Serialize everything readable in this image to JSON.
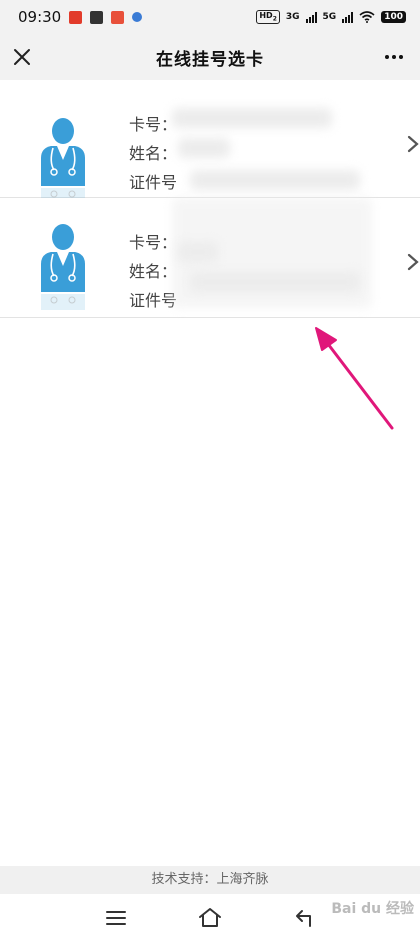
{
  "status_bar": {
    "time": "09:30",
    "notifications": [
      {
        "name": "news-app-icon",
        "color": "#e23b2a"
      },
      {
        "name": "check-app-icon",
        "color": "#333333"
      },
      {
        "name": "shop-app-icon",
        "color": "#e8503a"
      },
      {
        "name": "music-app-icon",
        "color": "#3a7bd5"
      }
    ],
    "hd_label": "HD",
    "hd_sub": "2",
    "network_1": "3G",
    "network_2": "5G",
    "battery": "100"
  },
  "header": {
    "title": "在线挂号选卡"
  },
  "cards": [
    {
      "card_label": "卡号：",
      "name_label": "姓名：",
      "id_label": "证件号",
      "card_value": "",
      "name_value": "",
      "id_value": ""
    },
    {
      "card_label": "卡号：",
      "name_label": "姓名：",
      "id_label": "证件号",
      "card_value": "",
      "name_value": "",
      "id_value": ""
    }
  ],
  "footer": {
    "support_text": "技术支持：上海齐脉"
  },
  "watermark": "Bai du 经验",
  "colors": {
    "accent": "#3a9ed8",
    "arrow": "#e0177a"
  }
}
